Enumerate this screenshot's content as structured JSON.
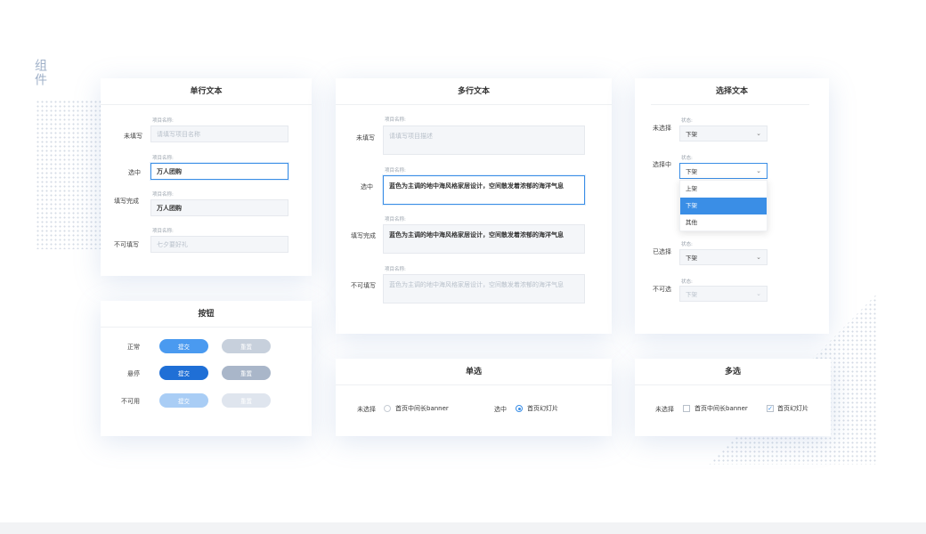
{
  "side_title": "组件",
  "single_line": {
    "title": "单行文本",
    "rows": [
      {
        "state": "未填写",
        "label": "项目名称:",
        "value": "请填写项目名称"
      },
      {
        "state": "选中",
        "label": "项目名称:",
        "value": "万人团购"
      },
      {
        "state": "填写完成",
        "label": "项目名称:",
        "value": "万人团购"
      },
      {
        "state": "不可填写",
        "label": "项目名称:",
        "value": "七夕要好礼"
      }
    ]
  },
  "multi_line": {
    "title": "多行文本",
    "rows": [
      {
        "state": "未填写",
        "label": "项目名称:",
        "value": "请填写项目描述"
      },
      {
        "state": "选中",
        "label": "项目名称:",
        "value": "蓝色为主调的地中海风格家居设计，空间散发着浓郁的海洋气息"
      },
      {
        "state": "填写完成",
        "label": "项目名称:",
        "value": "蓝色为主调的地中海风格家居设计，空间散发着浓郁的海洋气息"
      },
      {
        "state": "不可填写",
        "label": "项目名称:",
        "value": "蓝色为主调的地中海风格家居设计，空间散发着浓郁的海洋气息"
      }
    ]
  },
  "select_text": {
    "title": "选择文本",
    "rows": [
      {
        "state": "未选择",
        "label": "状态:",
        "value": "下架"
      },
      {
        "state": "选择中",
        "label": "状态:",
        "value": "下架"
      },
      {
        "state": "已选择",
        "label": "状态:",
        "value": "下架"
      },
      {
        "state": "不可选",
        "label": "状态:",
        "value": "下架"
      }
    ],
    "dropdown_options": [
      "上架",
      "下架",
      "其他"
    ],
    "dropdown_selected": "下架"
  },
  "buttons": {
    "title": "按钮",
    "rows": [
      {
        "state": "正常",
        "primary": "提交",
        "secondary": "重置"
      },
      {
        "state": "悬停",
        "primary": "提交",
        "secondary": "重置"
      },
      {
        "state": "不可用",
        "primary": "提交",
        "secondary": "重置"
      }
    ]
  },
  "radio": {
    "title": "单选",
    "unselected_state": "未选择",
    "unselected_option": "首页中间长banner",
    "selected_state": "选中",
    "selected_option": "首页幻灯片"
  },
  "checkbox": {
    "title": "多选",
    "state": "未选择",
    "option_unchecked": "首页中间长banner",
    "option_checked": "首页幻灯片",
    "check_mark": "✓"
  },
  "colors": {
    "accent": "#3a8ee6",
    "primary_normal": "#4a9af0",
    "primary_hover": "#1f6fd6",
    "primary_disabled": "#a9cdf5",
    "secondary_normal": "#c7d0dc",
    "secondary_hover": "#a9b6c9",
    "secondary_disabled": "#dfe5ee"
  },
  "icons": {
    "chevron": "chevron-down-icon"
  }
}
